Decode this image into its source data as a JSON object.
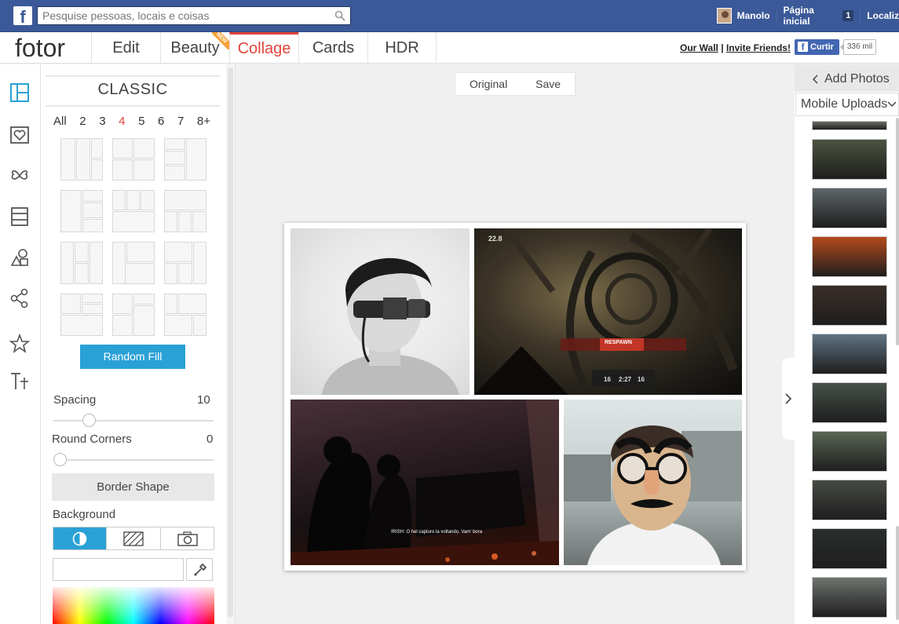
{
  "facebook": {
    "search_placeholder": "Pesquise pessoas, locais e coisas",
    "user_name": "Manolo",
    "home_label": "Página inicial",
    "home_badge": "1",
    "location_label": "Localiz"
  },
  "header": {
    "logo": "fotor",
    "tabs": [
      {
        "label": "Edit"
      },
      {
        "label": "Beauty",
        "badge": "NEW"
      },
      {
        "label": "Collage",
        "active": true
      },
      {
        "label": "Cards"
      },
      {
        "label": "HDR"
      }
    ],
    "our_wall": "Our Wall",
    "separator": "|",
    "invite": "Invite Friends!",
    "like_label": "Curtir",
    "like_count": "336 mil"
  },
  "left_panel": {
    "title": "CLASSIC",
    "counts": [
      "All",
      "2",
      "3",
      "4",
      "5",
      "6",
      "7",
      "8+"
    ],
    "selected_count": "4",
    "random_fill": "Random Fill",
    "spacing_label": "Spacing",
    "spacing_value": "10",
    "round_corners_label": "Round Corners",
    "round_corners_value": "0",
    "border_shape": "Border Shape",
    "background_label": "Background"
  },
  "canvas": {
    "original_label": "Original",
    "save_label": "Save",
    "cells": [
      {
        "description_icon": "photo-man-with-goggles"
      },
      {
        "description_icon": "photo-game-screenshot-hud"
      },
      {
        "description_icon": "photo-game-screenshot-dark"
      },
      {
        "description_icon": "photo-man-with-fake-glasses"
      }
    ],
    "game_hud_lines": [
      "22.8",
      "RESPAWN",
      "16",
      "2:27",
      "16"
    ],
    "subtitle_text": "IRISH: O hel capturo la voltando. Vam' bora"
  },
  "right_panel": {
    "add_photos": "Add Photos",
    "source": "Mobile Uploads",
    "thumb_colors": [
      "#6a6d66",
      "#4b5340",
      "#5e6669",
      "#b44a1c",
      "#3a2e28",
      "#5f7383",
      "#47514a",
      "#5a6655",
      "#474a44",
      "#2a2e2d",
      "#6e746f"
    ]
  },
  "colors": {
    "accent_red": "#e0443b",
    "accent_blue": "#2aa1d6",
    "facebook_blue": "#3b5998"
  }
}
